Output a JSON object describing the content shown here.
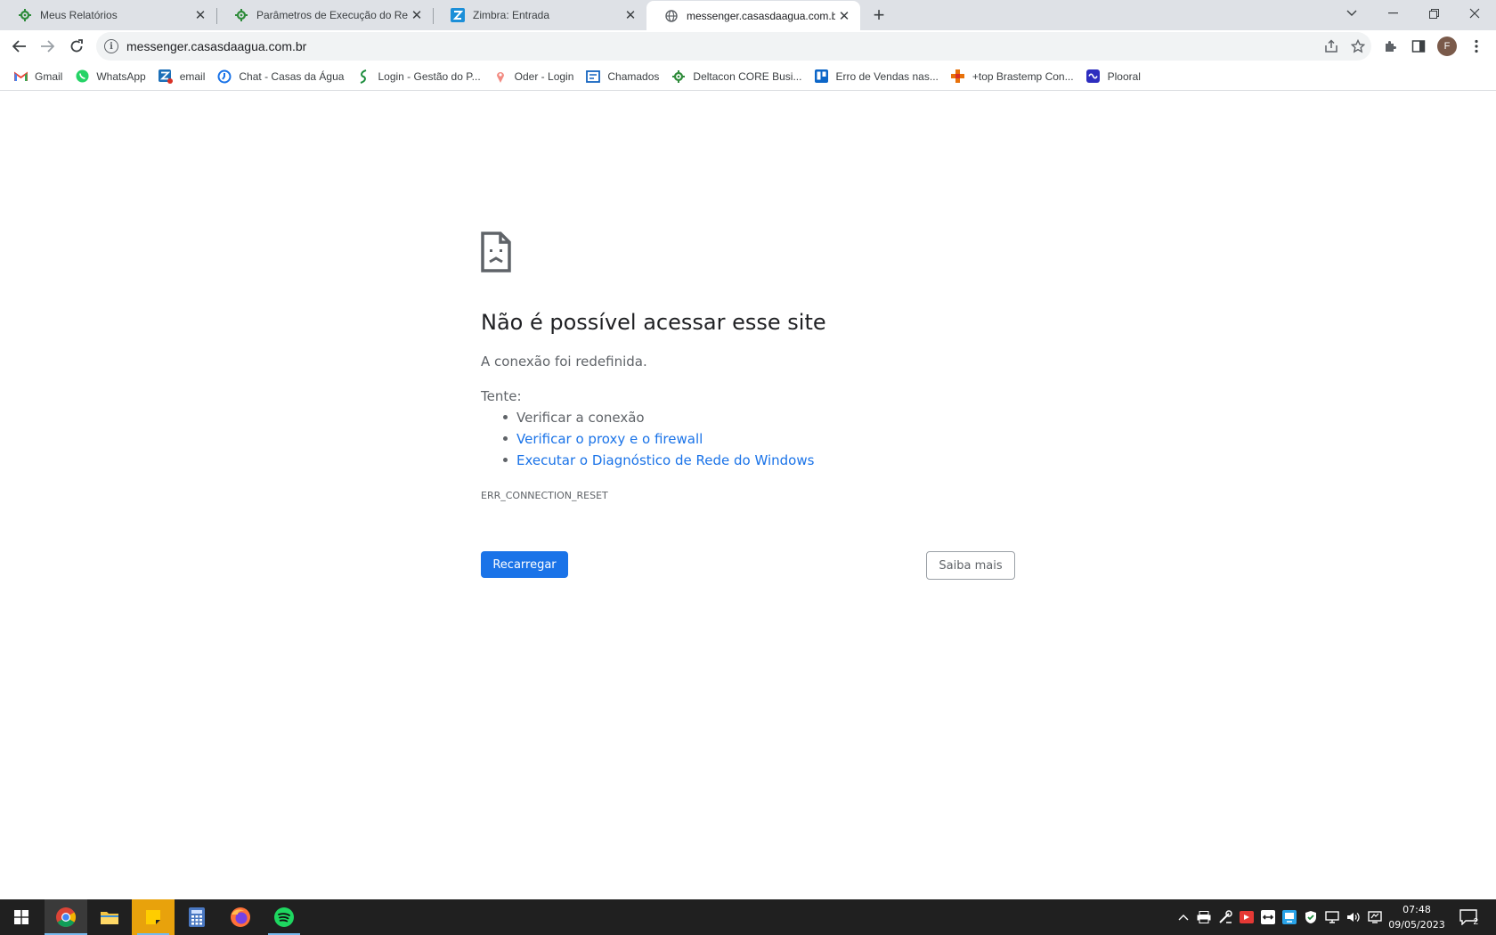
{
  "tabs": [
    {
      "title": "Meus Relatórios",
      "icon": "green-gear-icon",
      "active": false
    },
    {
      "title": "Parâmetros de Execução do Relat",
      "icon": "green-gear-icon",
      "active": false
    },
    {
      "title": "Zimbra: Entrada",
      "icon": "zimbra-z-icon",
      "active": false
    },
    {
      "title": "messenger.casasdaagua.com.br",
      "icon": "globe-icon",
      "active": true
    }
  ],
  "address_bar": {
    "url": "messenger.casasdaagua.com.br"
  },
  "profile": {
    "initial": "F"
  },
  "bookmarks": [
    {
      "label": "Gmail",
      "icon": "gmail-icon"
    },
    {
      "label": "WhatsApp",
      "icon": "whatsapp-icon"
    },
    {
      "label": "email",
      "icon": "zimbra-email-icon"
    },
    {
      "label": "Chat - Casas da Água",
      "icon": "chat-icon"
    },
    {
      "label": "Login - Gestão do P...",
      "icon": "leaf-icon"
    },
    {
      "label": "Oder - Login",
      "icon": "pin-icon"
    },
    {
      "label": "Chamados",
      "icon": "ticket-icon"
    },
    {
      "label": "Deltacon CORE Busi...",
      "icon": "green-gear-icon"
    },
    {
      "label": "Erro de Vendas nas...",
      "icon": "trello-icon"
    },
    {
      "label": "+top Brastemp Con...",
      "icon": "plus-icon"
    },
    {
      "label": "Plooral",
      "icon": "plooral-icon"
    }
  ],
  "error_page": {
    "title": "Não é possível acessar esse site",
    "subtitle": "A conexão foi redefinida.",
    "try_label": "Tente:",
    "suggestions": [
      {
        "text": "Verificar a conexão",
        "link": false
      },
      {
        "text": "Verificar o proxy e o firewall",
        "link": true
      },
      {
        "text": "Executar o Diagnóstico de Rede do Windows",
        "link": true
      }
    ],
    "error_code": "ERR_CONNECTION_RESET",
    "reload_button": "Recarregar",
    "learn_more_button": "Saiba mais"
  },
  "taskbar": {
    "apps": [
      "start-icon",
      "chrome-icon",
      "file-explorer-icon",
      "sticky-notes-icon",
      "calculator-icon",
      "firefox-icon",
      "spotify-icon"
    ],
    "clock_time": "07:48",
    "clock_date": "09/05/2023",
    "notification_count": "2"
  },
  "colors": {
    "accent_blue": "#1a73e8",
    "tabstrip_bg": "#dee1e6",
    "taskbar_bg": "#202020"
  }
}
